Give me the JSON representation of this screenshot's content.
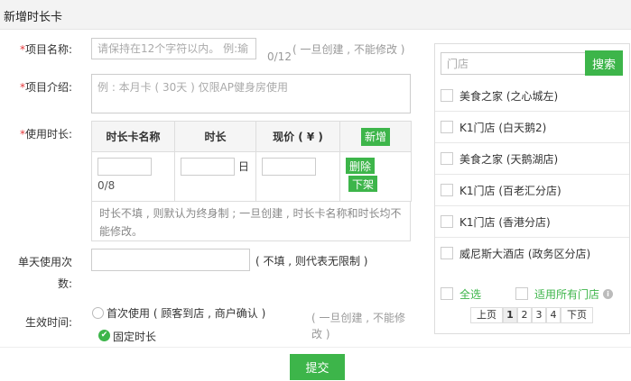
{
  "header": {
    "title": "新增时长卡"
  },
  "form": {
    "name_label": "项目名称:",
    "name_placeholder": "请保持在12个字符以内。 例:瑜",
    "name_counter": "0/12",
    "name_hint": "( 一旦创建 , 不能修改 )",
    "intro_label": "项目介绍:",
    "intro_placeholder": "例 : 本月卡 ( 30天 ) 仅限AP健身房使用",
    "duration_label": "使用时长:",
    "table": {
      "headers": [
        "时长卡名称",
        "时长",
        "现价 ( ¥ )"
      ],
      "add_label": "新增",
      "name_counter": "0/8",
      "day_unit": "日",
      "delete_label": "删除",
      "offline_label": "下架"
    },
    "duration_note": "时长不填 , 则默认为终身制 ; 一旦创建 , 时长卡名称和时长均不能修改。",
    "daily_label_1": "单天使用次",
    "daily_label_2": "数:",
    "daily_hint": "( 不填 , 则代表无限制 )",
    "effect_label": "生效时间:",
    "effect_option_1": "首次使用 ( 顾客到店 , 商户确认 )",
    "effect_option_2": "固定时长",
    "effect_hint": "( 一旦创建 , 不能修改 )"
  },
  "store_panel": {
    "search_placeholder": "门店",
    "search_button": "搜索",
    "stores": [
      "美食之家 (之心城左)",
      "K1门店 (白天鹅2)",
      "美食之家 (天鹅湖店)",
      "K1门店 (百老汇分店)",
      "K1门店 (香港分店)",
      "威尼斯大酒店 (政务区分店)"
    ],
    "select_all": "全选",
    "apply_all": "适用所有门店",
    "pager": {
      "prev": "上页",
      "pages": [
        "1",
        "2",
        "3",
        "4"
      ],
      "next": "下页"
    }
  },
  "footer": {
    "submit": "提交"
  }
}
